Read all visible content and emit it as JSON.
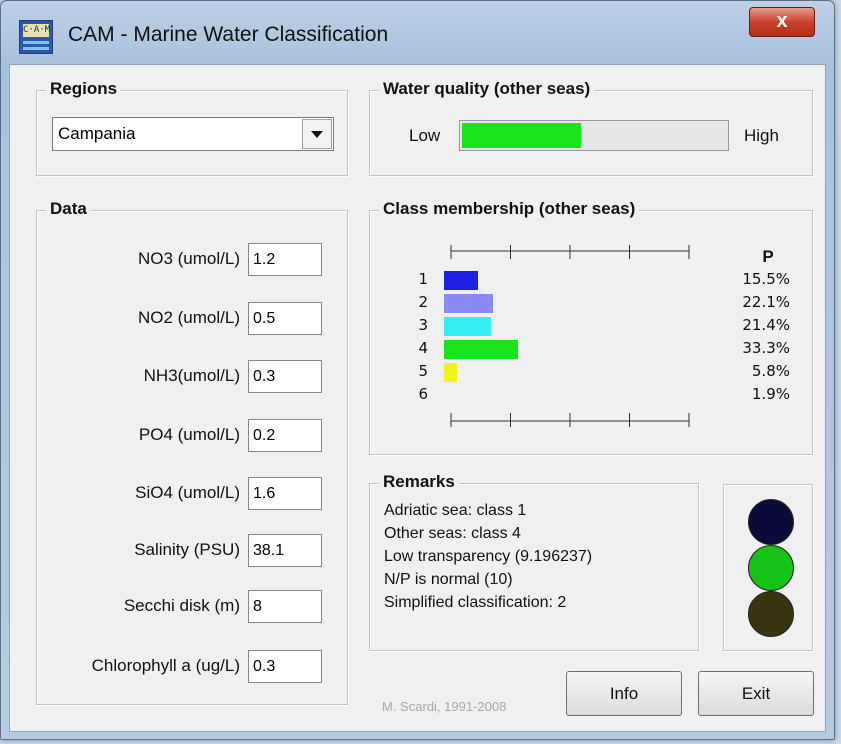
{
  "window": {
    "title": "CAM - Marine Water Classification",
    "close_glyph": "x"
  },
  "app_icon": {
    "text": "C·A·M"
  },
  "regions": {
    "title": "Regions",
    "selected": "Campania"
  },
  "data": {
    "title": "Data",
    "fields": [
      {
        "label": "NO3 (umol/L)",
        "value": "1.2"
      },
      {
        "label": "NO2 (umol/L)",
        "value": "0.5"
      },
      {
        "label": "NH3(umol/L)",
        "value": "0.3"
      },
      {
        "label": "PO4 (umol/L)",
        "value": "0.2"
      },
      {
        "label": "SiO4 (umol/L)",
        "value": "1.6"
      },
      {
        "label": "Salinity (PSU)",
        "value": "38.1"
      },
      {
        "label": "Secchi disk (m)",
        "value": "8"
      },
      {
        "label": "Chlorophyll a (ug/L)",
        "value": "0.3"
      }
    ]
  },
  "water_quality": {
    "title": "Water quality (other seas)",
    "low_label": "Low",
    "high_label": "High",
    "level": 0.45,
    "fill_color": "#19e319"
  },
  "membership": {
    "title": "Class membership (other seas)",
    "p_header": "P",
    "classes": [
      {
        "label": "1",
        "value": 15.5,
        "pct": "15.5%",
        "color": "#1f1fe0"
      },
      {
        "label": "2",
        "value": 22.1,
        "pct": "22.1%",
        "color": "#8a8af2"
      },
      {
        "label": "3",
        "value": 21.4,
        "pct": "21.4%",
        "color": "#33eef2"
      },
      {
        "label": "4",
        "value": 33.3,
        "pct": "33.3%",
        "color": "#19e319"
      },
      {
        "label": "5",
        "value": 5.8,
        "pct": "5.8%",
        "color": "#f2f21c"
      },
      {
        "label": "6",
        "value": 1.9,
        "pct": "1.9%",
        "color": "#f0f0f0"
      }
    ]
  },
  "remarks": {
    "title": "Remarks",
    "lines": [
      "Adriatic sea: class 1",
      "Other seas: class 4",
      "Low transparency (9.196237)",
      "N/P is normal (10)",
      "Simplified classification: 2"
    ]
  },
  "traffic_light": {
    "colors": [
      "#0b0b3a",
      "#17c217",
      "#3a3510"
    ]
  },
  "footer": {
    "credit": "M. Scardi, 1991-2008",
    "info_label": "Info",
    "exit_label": "Exit"
  }
}
